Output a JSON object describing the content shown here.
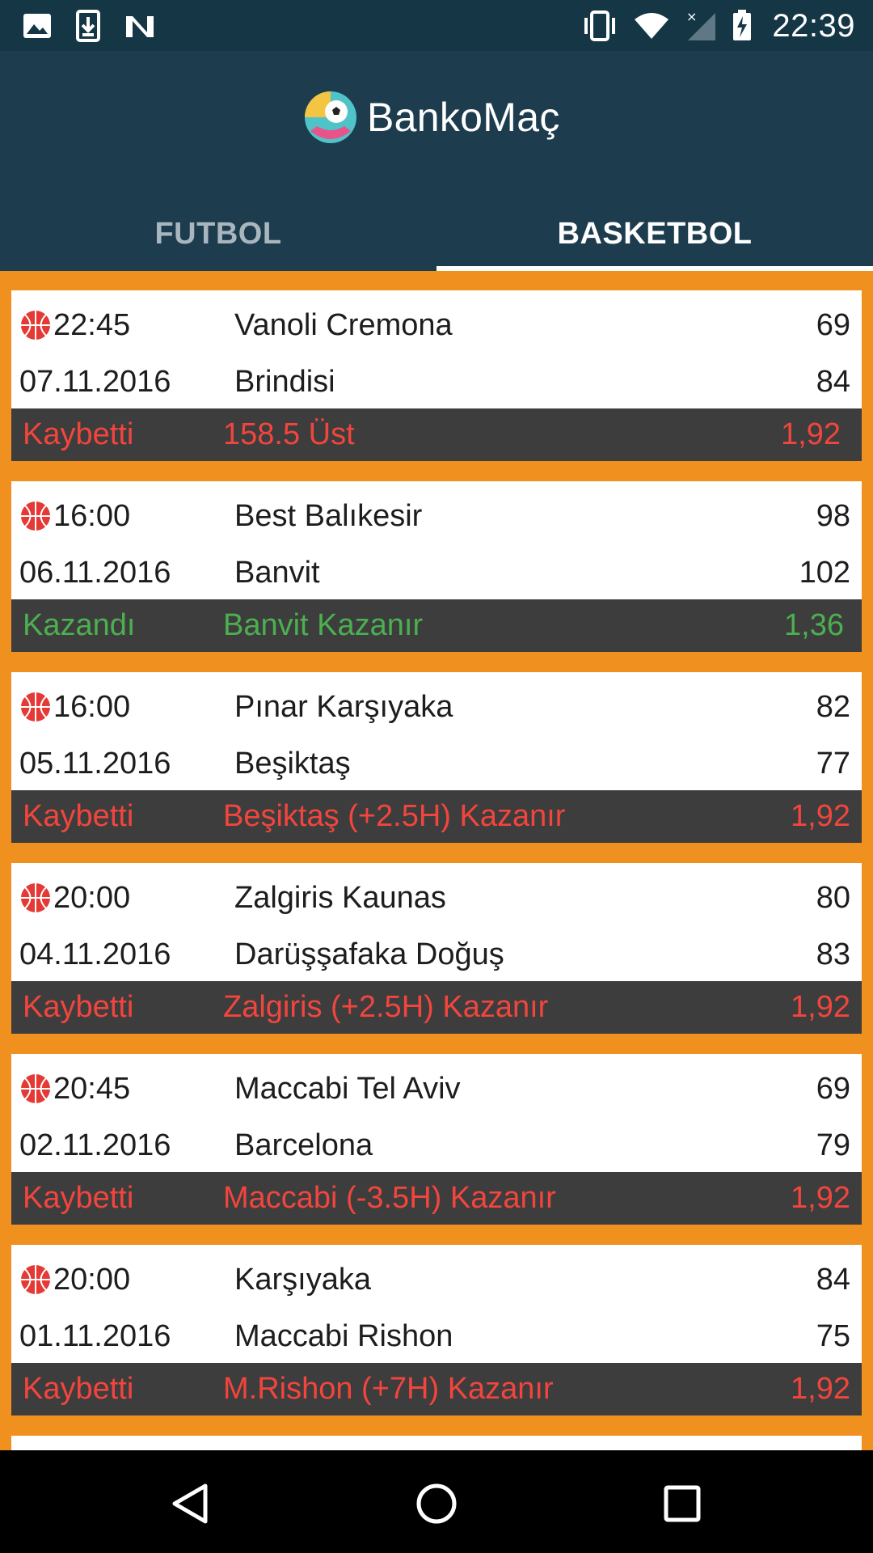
{
  "status_bar": {
    "time": "22:39",
    "left_icons": [
      "image-icon",
      "download-icon",
      "n-logo-icon"
    ],
    "right_icons": [
      "vibrate-icon",
      "wifi-icon",
      "signal-icon",
      "battery-charging-icon"
    ]
  },
  "app": {
    "title": "BankoMaç",
    "logo": "ball-logo-icon"
  },
  "tabs": [
    {
      "label": "FUTBOL",
      "selected": false
    },
    {
      "label": "BASKETBOL",
      "selected": true
    }
  ],
  "matches": [
    {
      "time": "22:45",
      "date": "07.11.2016",
      "home": "Vanoli Cremona",
      "away": "Brindisi",
      "home_score": "69",
      "away_score": "84",
      "status": "Kaybetti",
      "pick": "158.5 Üst",
      "odds": "1,92",
      "result": "lose"
    },
    {
      "time": "16:00",
      "date": "06.11.2016",
      "home": "Best Balıkesir",
      "away": "Banvit",
      "home_score": "98",
      "away_score": "102",
      "status": "Kazandı",
      "pick": "Banvit Kazanır",
      "odds": "1,36",
      "result": "win"
    },
    {
      "time": "16:00",
      "date": "05.11.2016",
      "home": "Pınar Karşıyaka",
      "away": "Beşiktaş",
      "home_score": "82",
      "away_score": "77",
      "status": "Kaybetti",
      "pick": "Beşiktaş (+2.5H) Kazanır",
      "odds": "1,92",
      "result": "lose"
    },
    {
      "time": "20:00",
      "date": "04.11.2016",
      "home": "Zalgiris Kaunas",
      "away": "Darüşşafaka Doğuş",
      "home_score": "80",
      "away_score": "83",
      "status": "Kaybetti",
      "pick": "Zalgiris (+2.5H) Kazanır",
      "odds": "1,92",
      "result": "lose"
    },
    {
      "time": "20:45",
      "date": "02.11.2016",
      "home": "Maccabi Tel Aviv",
      "away": "Barcelona",
      "home_score": "69",
      "away_score": "79",
      "status": "Kaybetti",
      "pick": "Maccabi (-3.5H) Kazanır",
      "odds": "1,92",
      "result": "lose"
    },
    {
      "time": "20:00",
      "date": "01.11.2016",
      "home": "Karşıyaka",
      "away": "Maccabi Rishon",
      "home_score": "84",
      "away_score": "75",
      "status": "Kaybetti",
      "pick": "M.Rishon (+7H) Kazanır",
      "odds": "1,92",
      "result": "lose"
    }
  ],
  "nav_bar": {
    "buttons": [
      "back-icon",
      "home-icon",
      "recents-icon"
    ]
  },
  "colors": {
    "status_bar": "#143645",
    "app_bar": "#1d3c4e",
    "background": "#f0901f",
    "result_bar": "#3d3d3d",
    "lose": "#f2453d",
    "win": "#4caf50"
  }
}
